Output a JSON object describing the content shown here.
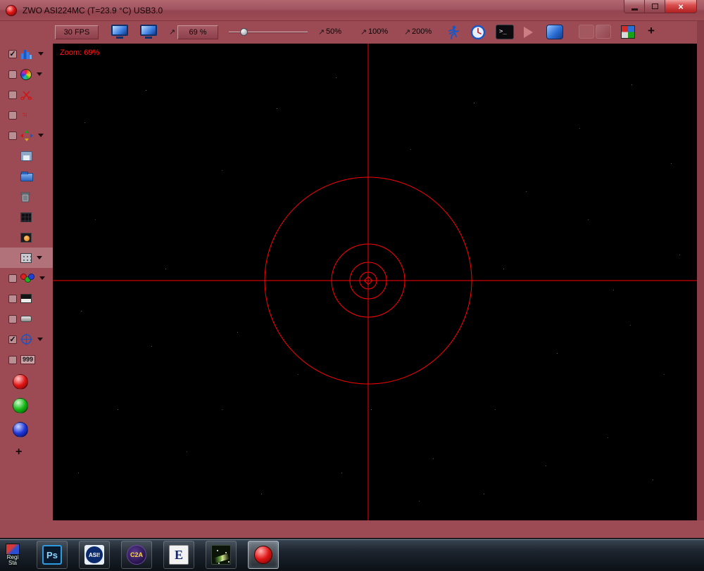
{
  "titlebar": {
    "title": "ZWO ASI224MC (T=23.9 °C) USB3.0",
    "close_glyph": "×"
  },
  "toolbar": {
    "fps_button": "30 FPS",
    "zoom_value_button": "69 %",
    "arrow_glyph": "↗",
    "preset_50": "50%",
    "preset_100": "100%",
    "preset_200": "200%",
    "terminal_glyph": ">_",
    "add_button": "+"
  },
  "viewport": {
    "zoom_overlay": "Zoom: 69%",
    "reticle_color": "#ff0000"
  },
  "sidebar": {
    "jupiter_glyph": "♃",
    "counter_item": "999",
    "add_button": "+"
  },
  "taskbar": {
    "registax": "Regi\nSta",
    "photoshop": "Ps",
    "asi": "ASI!",
    "c2a": "C2A",
    "e_app": "E"
  },
  "colors": {
    "frame": "#9c4b54",
    "viewport_bg": "#000000",
    "reticle": "#ff0000",
    "taskbar_bg": "#141b22",
    "accent_blue": "#2a6fd4"
  }
}
